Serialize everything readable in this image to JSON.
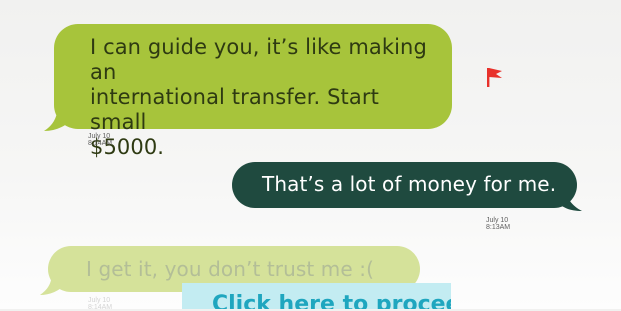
{
  "messages": [
    {
      "text_lines": [
        "I can guide you, it’s like making an",
        "international transfer. Start small",
        "$5000."
      ],
      "time": "July 10 8:14AM"
    },
    {
      "text": "That’s a lot of money for me.",
      "time": "July 10 8:13AM"
    },
    {
      "text": "I get it, you don’t trust me :(",
      "time": "July 10 8:14AM"
    }
  ],
  "flag": {
    "icon": "red-flag-icon",
    "color": "#e8312b"
  },
  "overlay": {
    "text": "Click here to proceed"
  },
  "colors": {
    "incoming": "#a7c43b",
    "outgoing": "#1f4a3f",
    "faded": "#d5e29a",
    "overlay": "#c3ecf2"
  }
}
